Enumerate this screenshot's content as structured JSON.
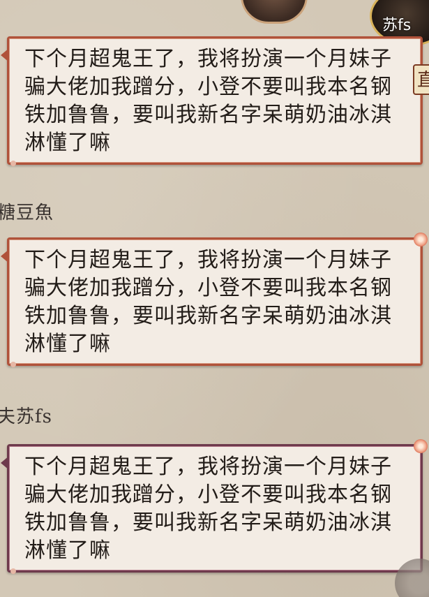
{
  "header": {
    "top_right_name": "苏fs",
    "side_badge_char": "直"
  },
  "messages": [
    {
      "sender": "",
      "text": "下个月超鬼王了，我将扮演一个月妹子骗大佬加我蹭分，小登不要叫我本名钢铁加鲁鲁，要叫我新名字呆萌奶油冰淇淋懂了嘛"
    },
    {
      "sender": "糖豆魚",
      "text": "下个月超鬼王了，我将扮演一个月妹子骗大佬加我蹭分，小登不要叫我本名钢铁加鲁鲁，要叫我新名字呆萌奶油冰淇淋懂了嘛"
    },
    {
      "sender": "夫苏fs",
      "text": "下个月超鬼王了，我将扮演一个月妹子骗大佬加我蹭分，小登不要叫我本名钢铁加鲁鲁，要叫我新名字呆萌奶油冰淇淋懂了嘛"
    }
  ],
  "colors": {
    "background": "#d3c8b6",
    "bubble_fill": "#f3ece4",
    "bubble_border": "#b0523a",
    "bubble_border_self": "#6e3a4c",
    "text": "#221c18"
  },
  "icons": {
    "left_avatar": "avatar-icon",
    "right_avatar": "avatar-icon",
    "corner": "emblem-icon"
  }
}
